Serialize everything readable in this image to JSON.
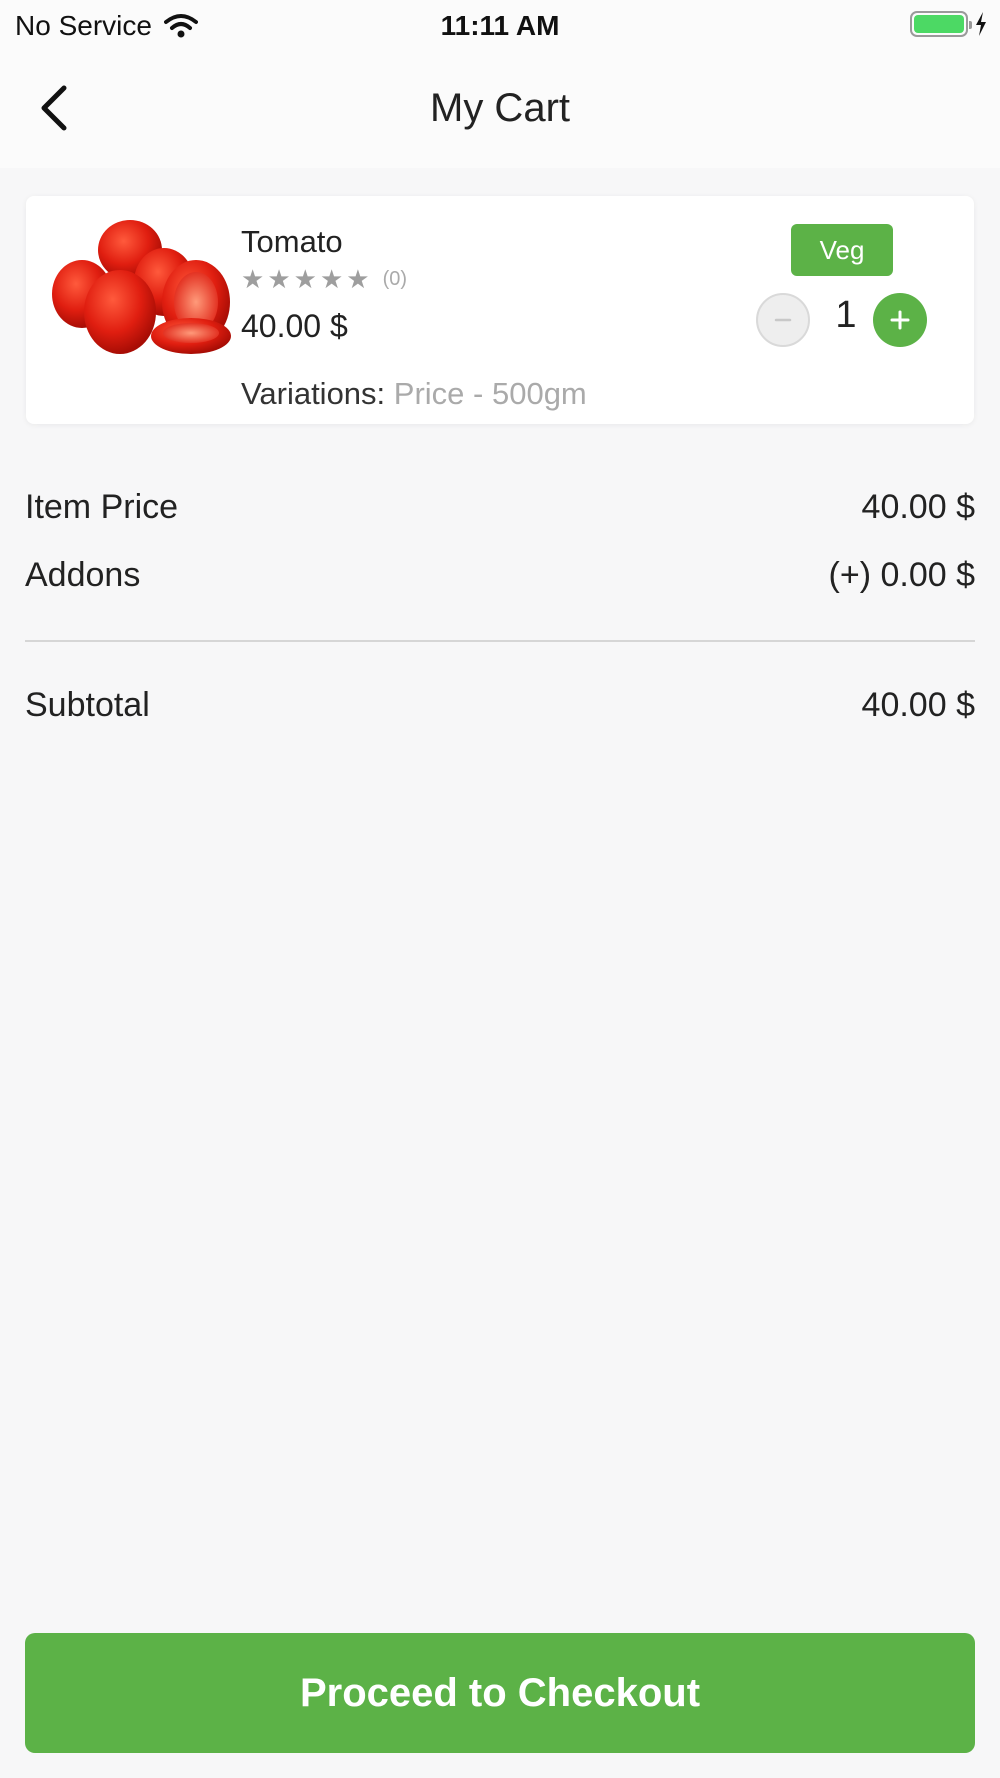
{
  "status_bar": {
    "carrier": "No Service",
    "time": "11:11 AM",
    "battery_color": "#4cd964"
  },
  "header": {
    "back_icon": "chevron-left-icon",
    "title": "My Cart"
  },
  "cart": {
    "items": [
      {
        "name": "Tomato",
        "rating_stars": 0,
        "rating_count": "(0)",
        "price": "40.00 $",
        "badge": "Veg",
        "quantity": "1",
        "variations_label": "Variations:",
        "variations_value": "Price - 500gm"
      }
    ]
  },
  "summary": {
    "item_price_label": "Item Price",
    "item_price_value": "40.00 $",
    "addons_label": "Addons",
    "addons_value": "(+) 0.00 $",
    "subtotal_label": "Subtotal",
    "subtotal_value": "40.00 $"
  },
  "checkout": {
    "label": "Proceed to Checkout"
  },
  "colors": {
    "accent": "#5cb247",
    "background": "#f7f7f8"
  }
}
